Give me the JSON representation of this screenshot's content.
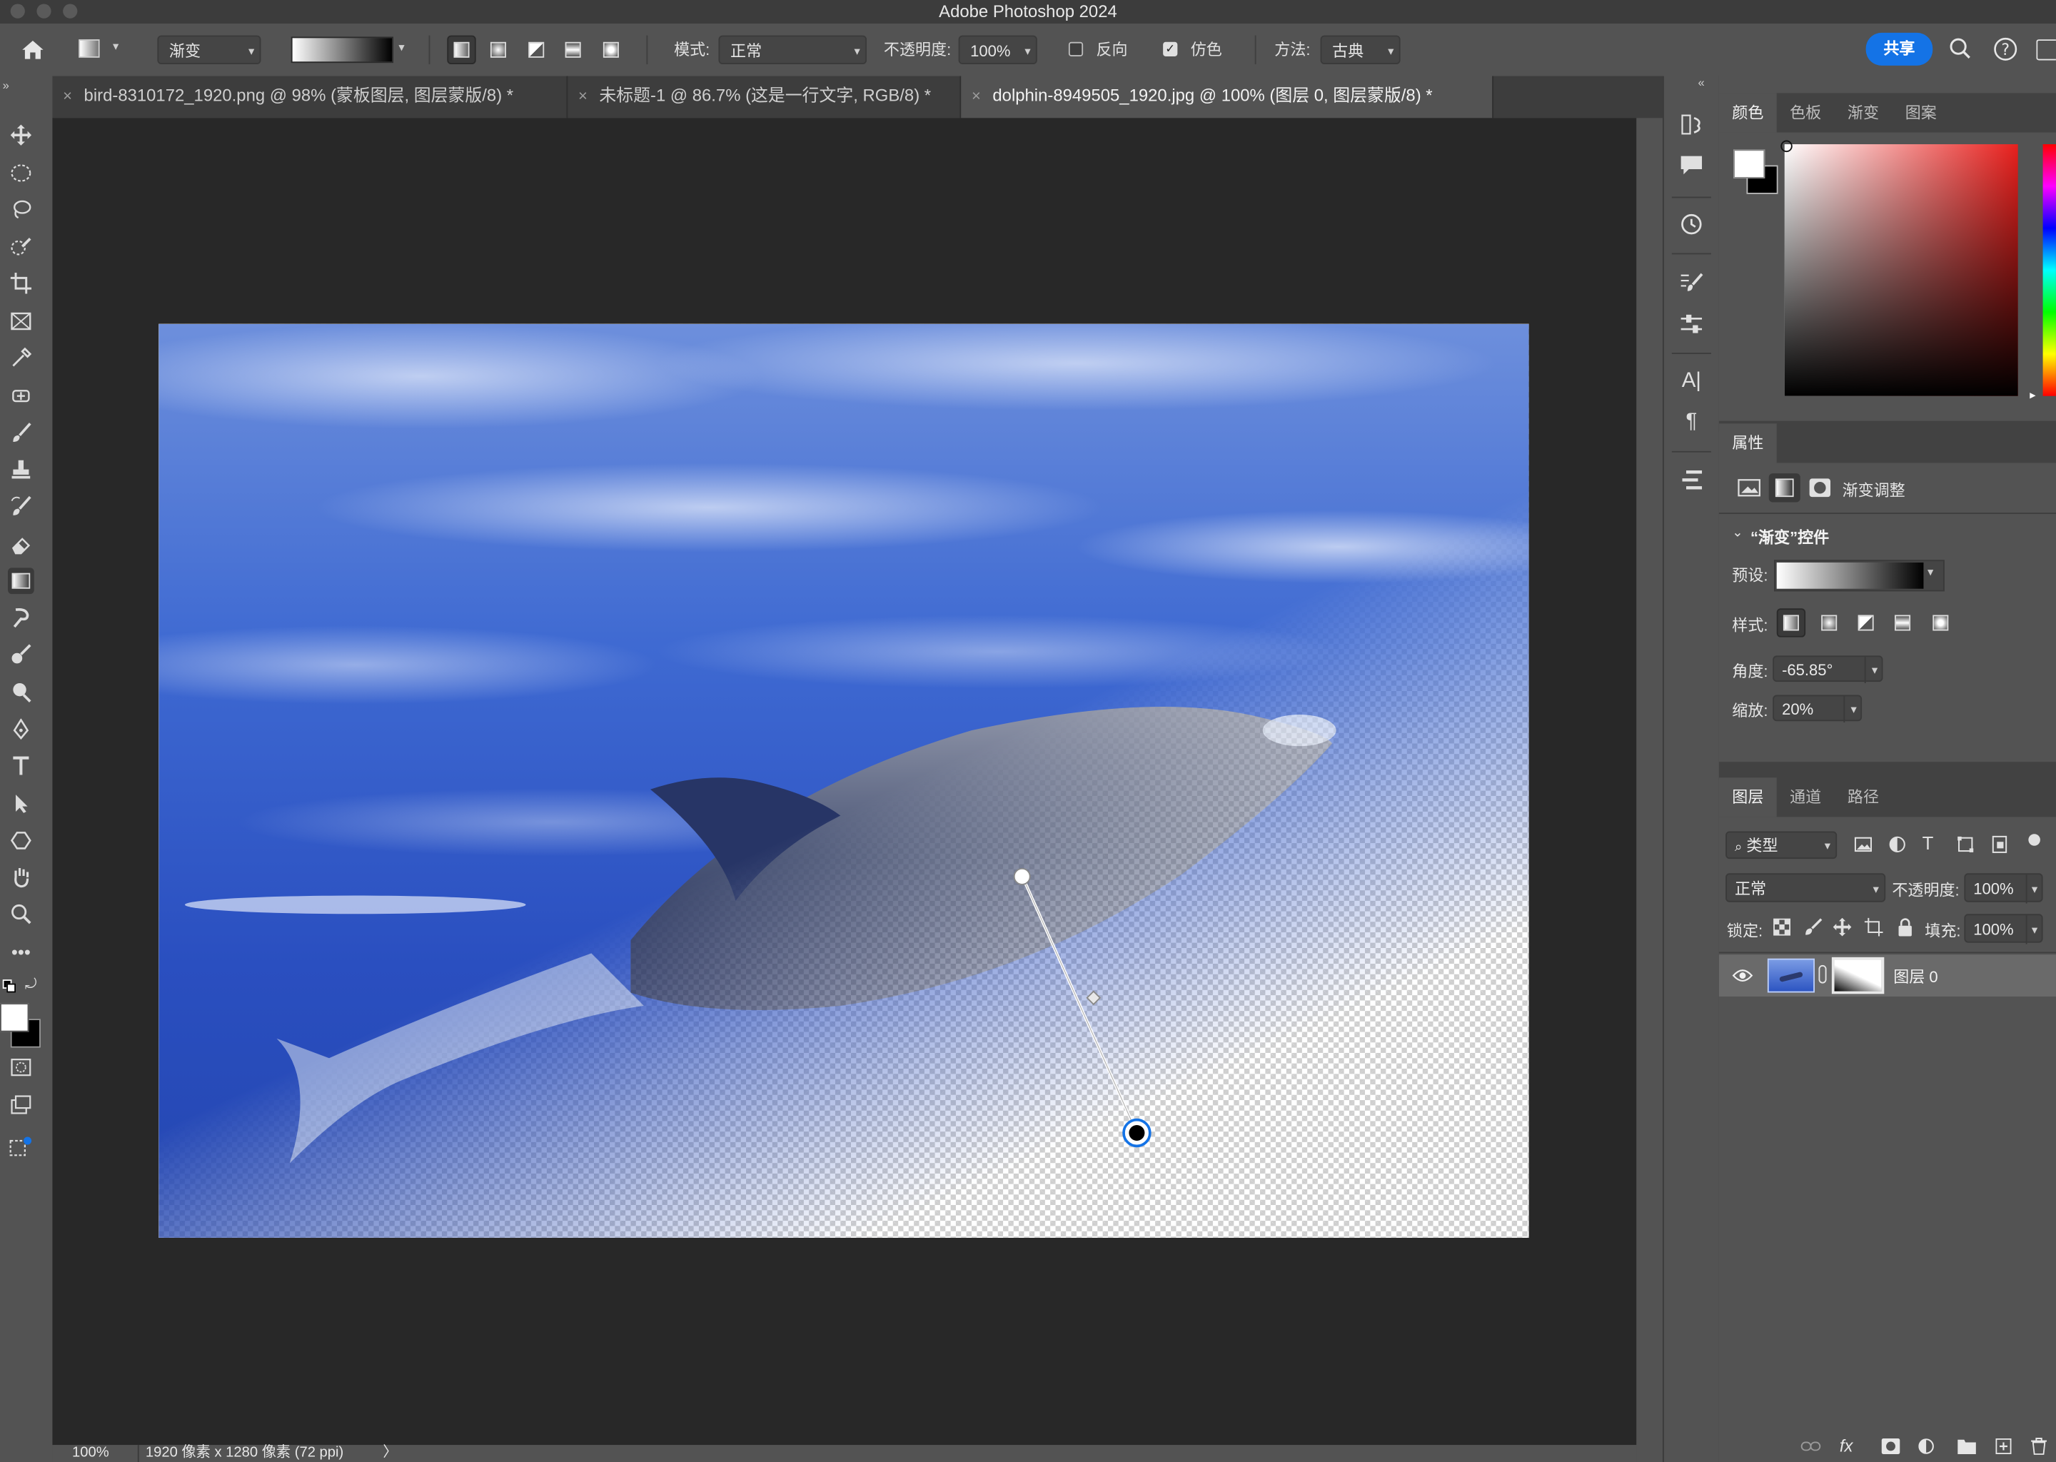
{
  "app": {
    "title": "Adobe Photoshop 2024"
  },
  "options_bar": {
    "tool_preset": "渐变",
    "mode_label": "模式:",
    "mode_value": "正常",
    "opacity_label": "不透明度:",
    "opacity_value": "100%",
    "reverse_label": "反向",
    "dither_label": "仿色",
    "method_label": "方法:",
    "method_value": "古典",
    "share_label": "共享"
  },
  "tabs": [
    {
      "label": "bird-8310172_1920.png @ 98% (蒙板图层, 图层蒙版/8) *"
    },
    {
      "label": "未标题-1 @ 86.7% (这是一行文字, RGB/8) *"
    },
    {
      "label": "dolphin-8949505_1920.jpg @ 100% (图层 0, 图层蒙版/8) *",
      "active": true
    }
  ],
  "status_bar": {
    "zoom": "100%",
    "doc_info": "1920 像素 x 1280 像素 (72 ppi)",
    "arrow": "〉"
  },
  "color_panel": {
    "tabs": [
      "颜色",
      "色板",
      "渐变",
      "图案"
    ]
  },
  "properties_panel": {
    "title": "属性",
    "subtitle": "渐变调整",
    "section": "“渐变”控件",
    "preset_label": "预设:",
    "style_label": "样式:",
    "angle_label": "角度:",
    "angle_value": "-65.85°",
    "scale_label": "缩放:",
    "scale_value": "20%"
  },
  "layers_panel": {
    "tabs": [
      "图层",
      "通道",
      "路径"
    ],
    "filter_label": "类型",
    "blend_mode": "正常",
    "opacity_label": "不透明度:",
    "opacity_value": "100%",
    "lock_label": "锁定:",
    "fill_label": "填充:",
    "fill_value": "100%",
    "layers": [
      {
        "name": "图层 0"
      }
    ],
    "footer_fx": "fx"
  },
  "colors": {
    "accent": "#1473e6",
    "panel_bg": "#535353",
    "canvas_bg": "#282828"
  }
}
